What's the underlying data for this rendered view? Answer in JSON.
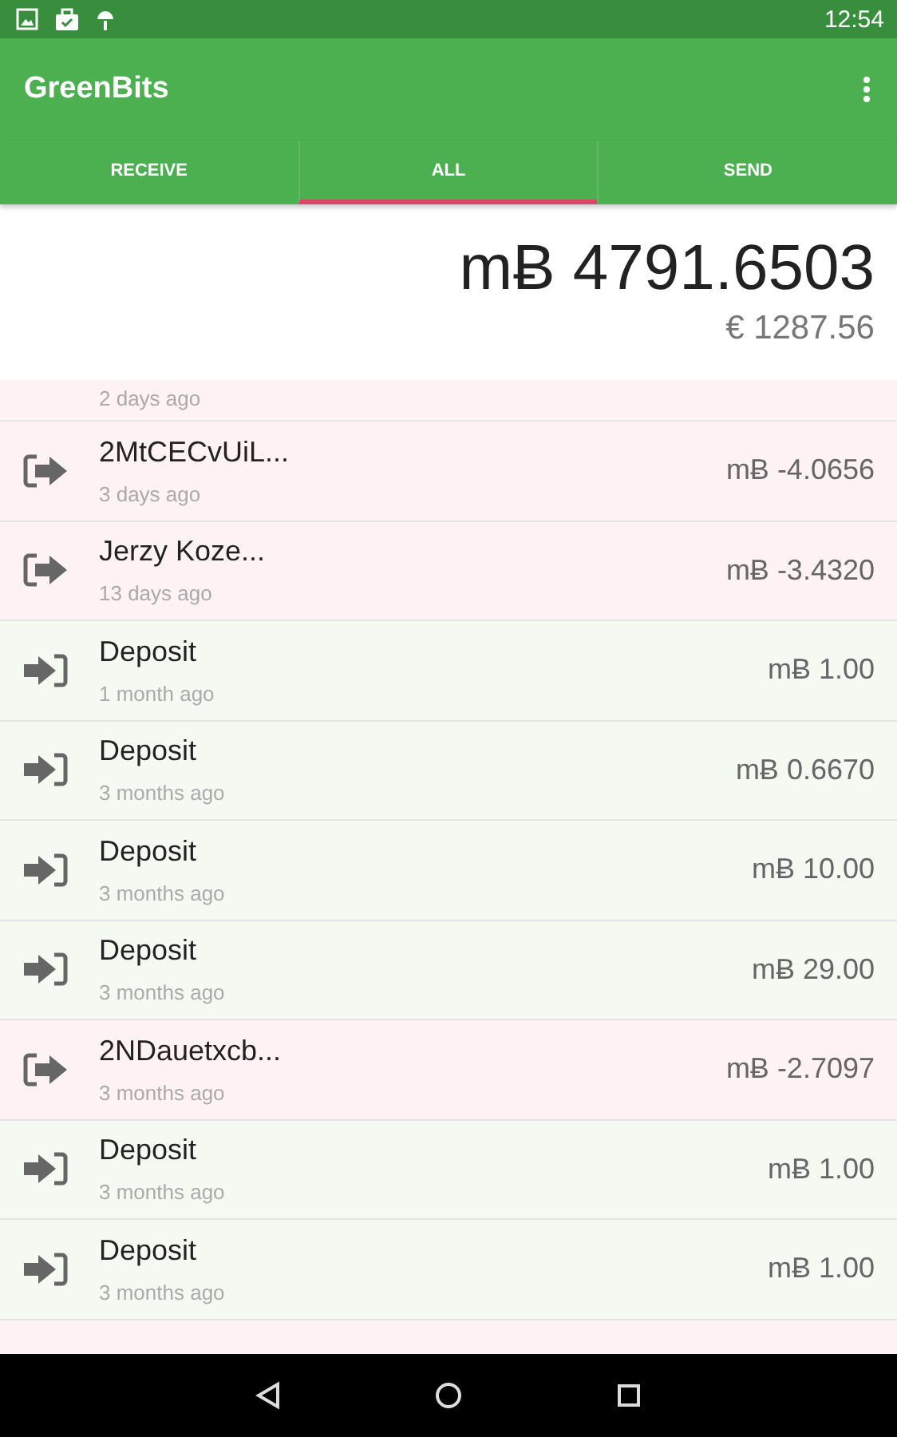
{
  "status_bar": {
    "time": "12:54"
  },
  "app_bar": {
    "title": "GreenBits"
  },
  "tabs": [
    {
      "label": "RECEIVE",
      "selected": false
    },
    {
      "label": "ALL",
      "selected": true
    },
    {
      "label": "SEND",
      "selected": false
    }
  ],
  "balance": {
    "amount": "mɃ 4791.6503",
    "fiat": "€ 1287.56"
  },
  "transactions": [
    {
      "kind": "send",
      "cut_top": true,
      "cut_bottom": false,
      "time": "2 days ago"
    },
    {
      "kind": "send",
      "cut_top": false,
      "cut_bottom": false,
      "name": "2MtCECvUiL...",
      "time": "3 days ago",
      "amount": "mɃ -4.0656"
    },
    {
      "kind": "send",
      "cut_top": false,
      "cut_bottom": false,
      "name": "Jerzy Koze...",
      "time": "13 days ago",
      "amount": "mɃ -3.4320"
    },
    {
      "kind": "receive",
      "cut_top": false,
      "cut_bottom": false,
      "name": "Deposit",
      "time": "1 month ago",
      "amount": "mɃ 1.00"
    },
    {
      "kind": "receive",
      "cut_top": false,
      "cut_bottom": false,
      "name": "Deposit",
      "time": "3 months ago",
      "amount": "mɃ 0.6670"
    },
    {
      "kind": "receive",
      "cut_top": false,
      "cut_bottom": false,
      "name": "Deposit",
      "time": "3 months ago",
      "amount": "mɃ 10.00"
    },
    {
      "kind": "receive",
      "cut_top": false,
      "cut_bottom": false,
      "name": "Deposit",
      "time": "3 months ago",
      "amount": "mɃ 29.00"
    },
    {
      "kind": "send",
      "cut_top": false,
      "cut_bottom": false,
      "name": "2NDauetxcb...",
      "time": "3 months ago",
      "amount": "mɃ -2.7097"
    },
    {
      "kind": "receive",
      "cut_top": false,
      "cut_bottom": false,
      "name": "Deposit",
      "time": "3 months ago",
      "amount": "mɃ 1.00"
    },
    {
      "kind": "receive",
      "cut_top": false,
      "cut_bottom": false,
      "name": "Deposit",
      "time": "3 months ago",
      "amount": "mɃ 1.00"
    },
    {
      "kind": "send",
      "cut_top": false,
      "cut_bottom": true
    }
  ]
}
